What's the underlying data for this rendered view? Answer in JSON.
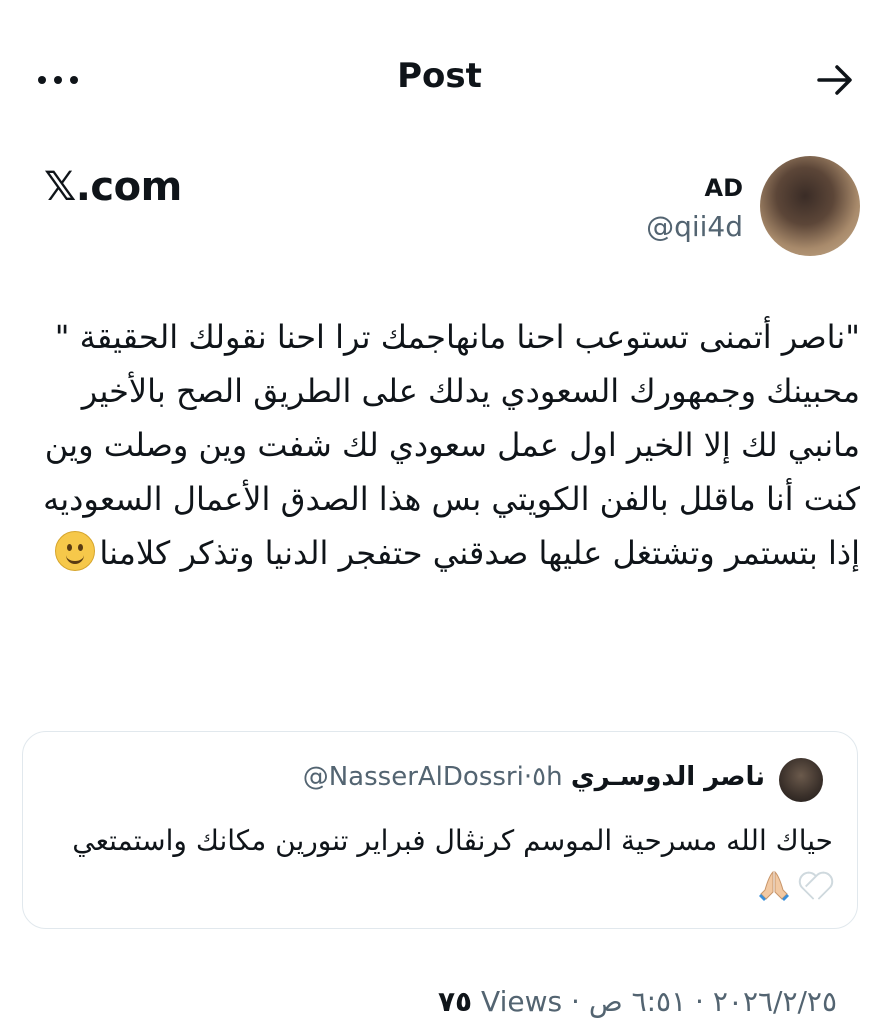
{
  "header": {
    "title": "Post",
    "more_icon": "more-horizontal-icon",
    "forward_icon": "arrow-right-icon"
  },
  "brand": {
    "text": "𝕏.com"
  },
  "author": {
    "display_name": "AD",
    "handle": "@qii4d"
  },
  "tweet": {
    "text": "\"ناصر أتمنى تستوعب احنا مانهاجمك ترا احنا نقولك الحقيقة \"\nمحبينك وجمهورك السعودي يدلك على الطريق الصح بالأخير مانبي لك إلا الخير اول عمل سعودي لك شفت وين وصلت وين كنت أنا ماقلل بالفن الكويتي بس هذا الصدق الأعمال السعوديه إذا بتستمر وتشتغل عليها صدقني حتفجر الدنيا وتذكر كلامنا",
    "emoji": "slightly-smiling-face"
  },
  "quote": {
    "name": "ناصر الدوسـري",
    "handle": "@NasserAlDossri",
    "separator": "·",
    "time": "٥h",
    "text": "حياك الله مسرحية الموسم كرنڤال فبراير تنورين مكانك واستمتعي",
    "emojis": [
      "white-heart",
      "folded-hands"
    ]
  },
  "footer": {
    "date": "٢٠٢٦/٢/٢٥",
    "sep": "·",
    "time": "٦:٥١ ص",
    "views_label": "Views",
    "views_count": "٧٥"
  },
  "colors": {
    "text": "#0f1419",
    "secondary": "#536471",
    "border": "#e1e8ed"
  }
}
